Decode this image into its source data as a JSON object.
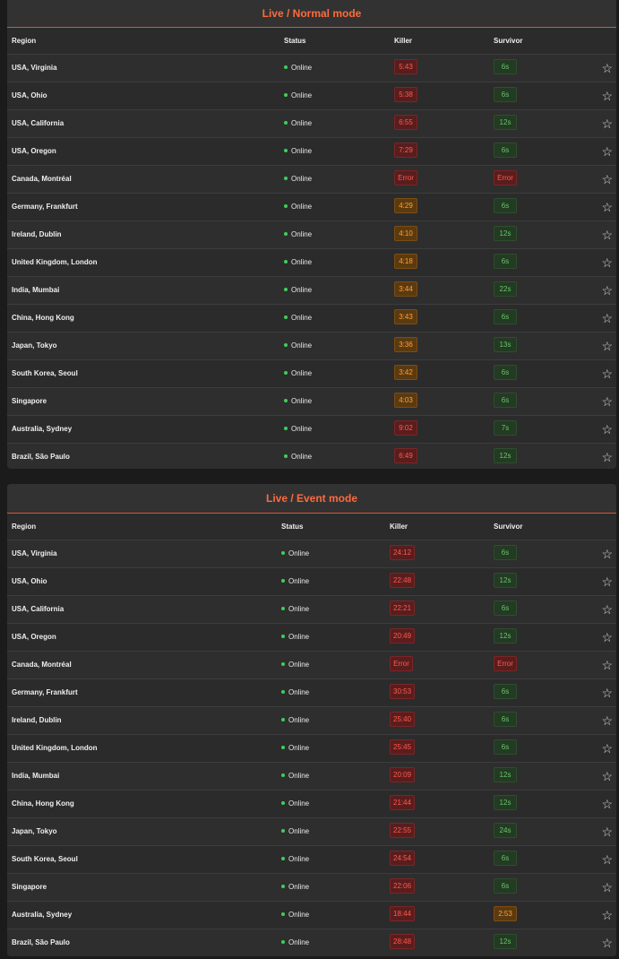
{
  "colors": {
    "accent": "#ff6a3d",
    "online_dot": "#3ecf5a",
    "red": "#ff5a4e",
    "orange": "#ffa22e",
    "green": "#68c66a"
  },
  "normal": {
    "title": "Live / Normal mode",
    "headers": {
      "region": "Region",
      "status": "Status",
      "killer": "Killer",
      "survivor": "Survivor"
    },
    "rows": [
      {
        "region": "USA, Virginia",
        "status": "Online",
        "killer": "5:43",
        "killer_level": "red",
        "survivor": "6s",
        "survivor_level": "green"
      },
      {
        "region": "USA, Ohio",
        "status": "Online",
        "killer": "5:38",
        "killer_level": "red",
        "survivor": "6s",
        "survivor_level": "green"
      },
      {
        "region": "USA, California",
        "status": "Online",
        "killer": "6:55",
        "killer_level": "red",
        "survivor": "12s",
        "survivor_level": "green"
      },
      {
        "region": "USA, Oregon",
        "status": "Online",
        "killer": "7:29",
        "killer_level": "red",
        "survivor": "6s",
        "survivor_level": "green"
      },
      {
        "region": "Canada, Montréal",
        "status": "Online",
        "killer": "Error",
        "killer_level": "red",
        "survivor": "Error",
        "survivor_level": "red"
      },
      {
        "region": "Germany, Frankfurt",
        "status": "Online",
        "killer": "4:29",
        "killer_level": "orange",
        "survivor": "6s",
        "survivor_level": "green"
      },
      {
        "region": "Ireland, Dublin",
        "status": "Online",
        "killer": "4:10",
        "killer_level": "orange",
        "survivor": "12s",
        "survivor_level": "green"
      },
      {
        "region": "United Kingdom, London",
        "status": "Online",
        "killer": "4:18",
        "killer_level": "orange",
        "survivor": "6s",
        "survivor_level": "green"
      },
      {
        "region": "India, Mumbai",
        "status": "Online",
        "killer": "3:44",
        "killer_level": "orange",
        "survivor": "22s",
        "survivor_level": "green"
      },
      {
        "region": "China, Hong Kong",
        "status": "Online",
        "killer": "3:43",
        "killer_level": "orange",
        "survivor": "6s",
        "survivor_level": "green"
      },
      {
        "region": "Japan, Tokyo",
        "status": "Online",
        "killer": "3:36",
        "killer_level": "orange",
        "survivor": "13s",
        "survivor_level": "green"
      },
      {
        "region": "South Korea, Seoul",
        "status": "Online",
        "killer": "3:42",
        "killer_level": "orange",
        "survivor": "6s",
        "survivor_level": "green"
      },
      {
        "region": "Singapore",
        "status": "Online",
        "killer": "4:03",
        "killer_level": "orange",
        "survivor": "6s",
        "survivor_level": "green"
      },
      {
        "region": "Australia, Sydney",
        "status": "Online",
        "killer": "9:02",
        "killer_level": "red",
        "survivor": "7s",
        "survivor_level": "green"
      },
      {
        "region": "Brazil, São Paulo",
        "status": "Online",
        "killer": "6:49",
        "killer_level": "red",
        "survivor": "12s",
        "survivor_level": "green"
      }
    ]
  },
  "event": {
    "title": "Live / Event mode",
    "headers": {
      "region": "Region",
      "status": "Status",
      "killer": "Killer",
      "survivor": "Survivor"
    },
    "rows": [
      {
        "region": "USA, Virginia",
        "status": "Online",
        "killer": "24:12",
        "killer_level": "red",
        "survivor": "6s",
        "survivor_level": "green"
      },
      {
        "region": "USA, Ohio",
        "status": "Online",
        "killer": "22:48",
        "killer_level": "red",
        "survivor": "12s",
        "survivor_level": "green"
      },
      {
        "region": "USA, California",
        "status": "Online",
        "killer": "22:21",
        "killer_level": "red",
        "survivor": "6s",
        "survivor_level": "green"
      },
      {
        "region": "USA, Oregon",
        "status": "Online",
        "killer": "20:49",
        "killer_level": "red",
        "survivor": "12s",
        "survivor_level": "green"
      },
      {
        "region": "Canada, Montréal",
        "status": "Online",
        "killer": "Error",
        "killer_level": "red",
        "survivor": "Error",
        "survivor_level": "red"
      },
      {
        "region": "Germany, Frankfurt",
        "status": "Online",
        "killer": "30:53",
        "killer_level": "red",
        "survivor": "6s",
        "survivor_level": "green"
      },
      {
        "region": "Ireland, Dublin",
        "status": "Online",
        "killer": "25:40",
        "killer_level": "red",
        "survivor": "6s",
        "survivor_level": "green"
      },
      {
        "region": "United Kingdom, London",
        "status": "Online",
        "killer": "25:45",
        "killer_level": "red",
        "survivor": "6s",
        "survivor_level": "green"
      },
      {
        "region": "India, Mumbai",
        "status": "Online",
        "killer": "20:09",
        "killer_level": "red",
        "survivor": "12s",
        "survivor_level": "green"
      },
      {
        "region": "China, Hong Kong",
        "status": "Online",
        "killer": "21:44",
        "killer_level": "red",
        "survivor": "12s",
        "survivor_level": "green"
      },
      {
        "region": "Japan, Tokyo",
        "status": "Online",
        "killer": "22:55",
        "killer_level": "red",
        "survivor": "24s",
        "survivor_level": "green"
      },
      {
        "region": "South Korea, Seoul",
        "status": "Online",
        "killer": "24:54",
        "killer_level": "red",
        "survivor": "6s",
        "survivor_level": "green"
      },
      {
        "region": "Singapore",
        "status": "Online",
        "killer": "22:06",
        "killer_level": "red",
        "survivor": "6s",
        "survivor_level": "green"
      },
      {
        "region": "Australia, Sydney",
        "status": "Online",
        "killer": "18:44",
        "killer_level": "red",
        "survivor": "2:53",
        "survivor_level": "orange"
      },
      {
        "region": "Brazil, São Paulo",
        "status": "Online",
        "killer": "28:48",
        "killer_level": "red",
        "survivor": "12s",
        "survivor_level": "green"
      }
    ]
  }
}
